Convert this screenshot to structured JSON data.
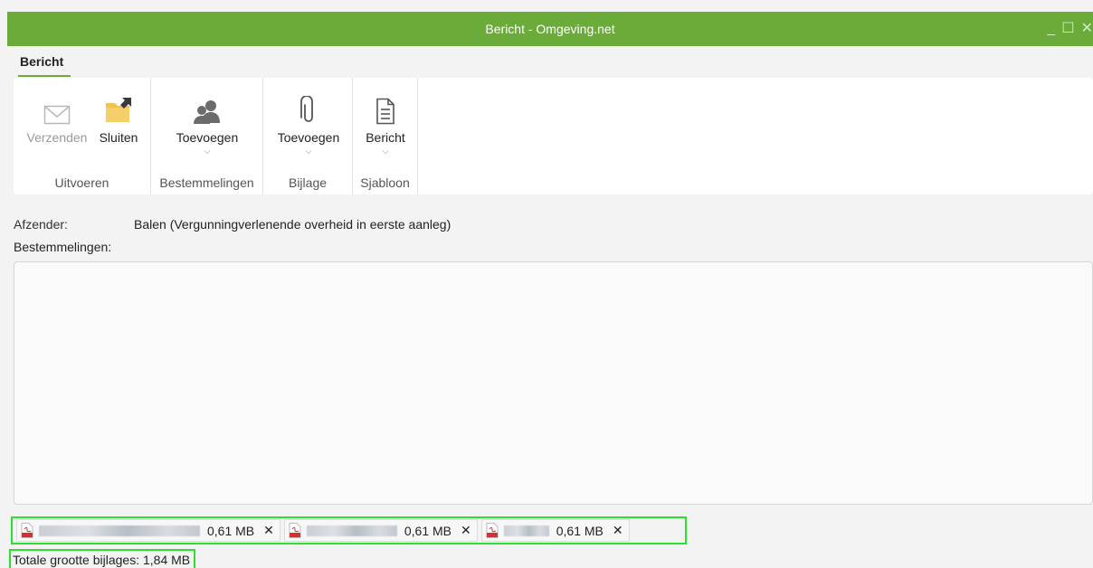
{
  "window": {
    "title": "Bericht - Omgeving.net",
    "controls": {
      "minimize": "_",
      "maximize": "☐",
      "close": "✕"
    }
  },
  "menu": {
    "active_tab": "Bericht"
  },
  "ribbon": {
    "groups": [
      {
        "label": "Uitvoeren",
        "buttons": [
          {
            "label": "Verzenden",
            "icon": "envelope-icon",
            "enabled": false
          },
          {
            "label": "Sluiten",
            "icon": "folder-close-icon",
            "enabled": true
          }
        ]
      },
      {
        "label": "Bestemmelingen",
        "buttons": [
          {
            "label": "Toevoegen",
            "icon": "people-icon",
            "dropdown": true
          }
        ]
      },
      {
        "label": "Bijlage",
        "buttons": [
          {
            "label": "Toevoegen",
            "icon": "paperclip-icon",
            "dropdown": true
          }
        ]
      },
      {
        "label": "Sjabloon",
        "buttons": [
          {
            "label": "Bericht",
            "icon": "document-icon",
            "dropdown": true
          }
        ]
      }
    ],
    "chevron": "⌵"
  },
  "form": {
    "sender_label": "Afzender:",
    "sender_value": "Balen (Vergunningverlenende overheid in eerste aanleg)",
    "recipients_label": "Bestemmelingen:",
    "body_text": ""
  },
  "attachments": [
    {
      "name": "",
      "size": "0,61 MB",
      "remove": "✕"
    },
    {
      "name": "",
      "size": "0,61 MB",
      "remove": "✕"
    },
    {
      "name": "",
      "size": "0,61 MB",
      "remove": "✕"
    }
  ],
  "total": "Totale grootte bijlages:  1,84 MB",
  "colors": {
    "accent": "#6aab3a",
    "highlight": "#2ee02e"
  }
}
